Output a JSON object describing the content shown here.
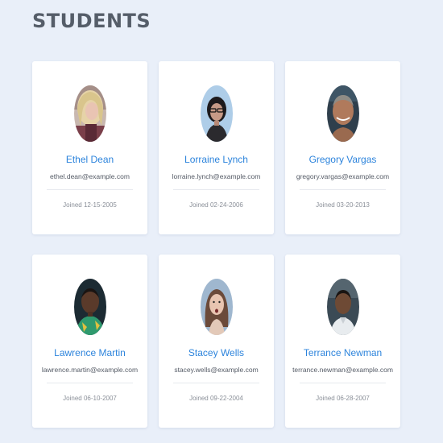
{
  "page": {
    "title": "STUDENTS"
  },
  "students": [
    {
      "name": "Ethel Dean",
      "email": "ethel.dean@example.com",
      "joined": "Joined 12-15-2005",
      "avatar_icon": "student-photo-icon"
    },
    {
      "name": "Lorraine Lynch",
      "email": "lorraine.lynch@example.com",
      "joined": "Joined 02-24-2006",
      "avatar_icon": "student-photo-icon"
    },
    {
      "name": "Gregory Vargas",
      "email": "gregory.vargas@example.com",
      "joined": "Joined 03-20-2013",
      "avatar_icon": "student-photo-icon"
    },
    {
      "name": "Lawrence Martin",
      "email": "lawrence.martin@example.com",
      "joined": "Joined 06-10-2007",
      "avatar_icon": "student-photo-icon"
    },
    {
      "name": "Stacey Wells",
      "email": "stacey.wells@example.com",
      "joined": "Joined 09-22-2004",
      "avatar_icon": "student-photo-icon"
    },
    {
      "name": "Terrance Newman",
      "email": "terrance.newman@example.com",
      "joined": "Joined 06-28-2007",
      "avatar_icon": "student-photo-icon"
    }
  ],
  "colors": {
    "background": "#e9eff9",
    "card": "#ffffff",
    "title": "#555d69",
    "name_link": "#2d84dc",
    "email_text": "#555b66",
    "joined_text": "#8a8f98"
  }
}
